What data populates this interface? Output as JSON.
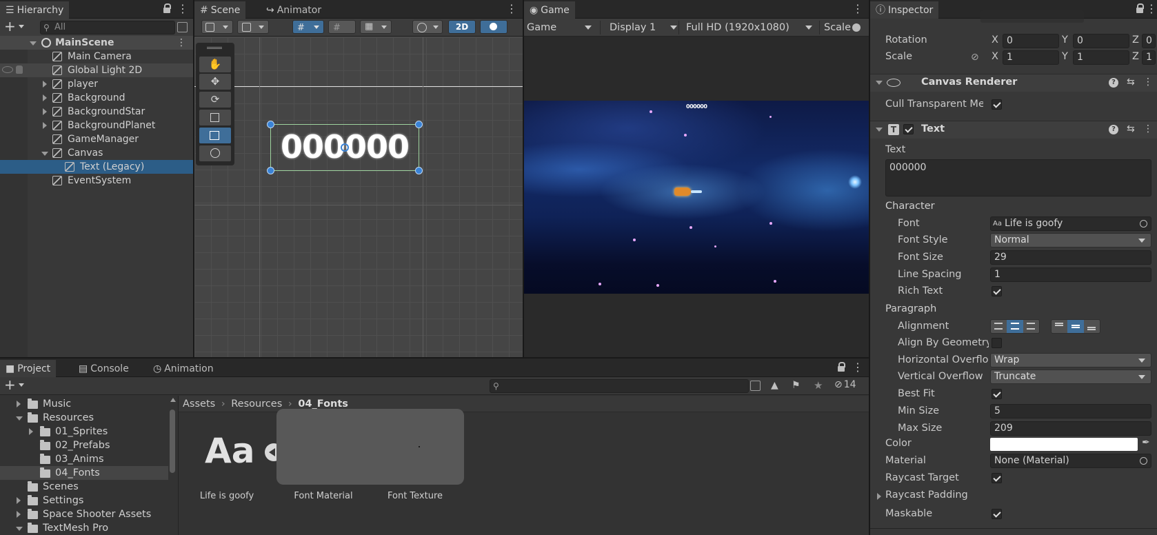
{
  "hierarchy": {
    "tab": "Hierarchy",
    "search_placeholder": "All",
    "scene": "MainScene",
    "items": [
      {
        "label": "Main Camera",
        "depth": 1,
        "expander": "none"
      },
      {
        "label": "Global Light 2D",
        "depth": 1,
        "expander": "none"
      },
      {
        "label": "player",
        "depth": 1,
        "expander": "collapsed"
      },
      {
        "label": "Background",
        "depth": 1,
        "expander": "collapsed"
      },
      {
        "label": "BackgroundStar",
        "depth": 1,
        "expander": "collapsed"
      },
      {
        "label": "BackgroundPlanet",
        "depth": 1,
        "expander": "collapsed"
      },
      {
        "label": "GameManager",
        "depth": 1,
        "expander": "none"
      },
      {
        "label": "Canvas",
        "depth": 1,
        "expander": "expanded"
      },
      {
        "label": "Text (Legacy)",
        "depth": 2,
        "expander": "none"
      },
      {
        "label": "EventSystem",
        "depth": 1,
        "expander": "none"
      }
    ]
  },
  "scene": {
    "tabs": [
      "Scene",
      "Animator"
    ],
    "mode_2d": "2D",
    "text_preview": "000000"
  },
  "game": {
    "tab": "Game",
    "mode": "Game",
    "display": "Display 1",
    "resolution": "Full HD (1920x1080)",
    "scale_label": "Scale",
    "hud_score": "000000"
  },
  "inspector": {
    "tab": "Inspector",
    "rotation_label": "Rotation",
    "scale_label": "Scale",
    "rotation": {
      "x": "0",
      "y": "0",
      "z": "0"
    },
    "scale": {
      "x": "1",
      "y": "1",
      "z": "1"
    },
    "canvas_renderer": {
      "title": "Canvas Renderer",
      "cull_label": "Cull Transparent Mes"
    },
    "text_component": {
      "title": "Text",
      "text_label": "Text",
      "text_value": "000000",
      "character_header": "Character",
      "font_label": "Font",
      "font_value": "Life is goofy",
      "font_style_label": "Font Style",
      "font_style_value": "Normal",
      "font_size_label": "Font Size",
      "font_size_value": "29",
      "line_spacing_label": "Line Spacing",
      "line_spacing_value": "1",
      "rich_text_label": "Rich Text",
      "paragraph_header": "Paragraph",
      "alignment_label": "Alignment",
      "align_geometry_label": "Align By Geometry",
      "h_overflow_label": "Horizontal Overflo",
      "h_overflow_value": "Wrap",
      "v_overflow_label": "Vertical Overflow",
      "v_overflow_value": "Truncate",
      "best_fit_label": "Best Fit",
      "min_size_label": "Min Size",
      "min_size_value": "5",
      "max_size_label": "Max Size",
      "max_size_value": "209",
      "color_label": "Color",
      "color_value": "#ffffff",
      "material_label": "Material",
      "material_value": "None (Material)",
      "raycast_target_label": "Raycast Target",
      "raycast_padding_label": "Raycast Padding",
      "maskable_label": "Maskable"
    }
  },
  "project": {
    "tabs": [
      "Project",
      "Console",
      "Animation"
    ],
    "hidden_count": "14",
    "tree": [
      {
        "label": "Music",
        "depth": 1,
        "expander": "collapsed"
      },
      {
        "label": "Resources",
        "depth": 1,
        "expander": "expanded"
      },
      {
        "label": "01_Sprites",
        "depth": 2,
        "expander": "collapsed"
      },
      {
        "label": "02_Prefabs",
        "depth": 2,
        "expander": "none"
      },
      {
        "label": "03_Anims",
        "depth": 2,
        "expander": "none"
      },
      {
        "label": "04_Fonts",
        "depth": 2,
        "expander": "none"
      },
      {
        "label": "Scenes",
        "depth": 1,
        "expander": "none"
      },
      {
        "label": "Settings",
        "depth": 1,
        "expander": "collapsed"
      },
      {
        "label": "Space Shooter Assets",
        "depth": 1,
        "expander": "collapsed"
      },
      {
        "label": "TextMesh Pro",
        "depth": 1,
        "expander": "expanded"
      }
    ],
    "breadcrumb": [
      "Assets",
      "Resources",
      "04_Fonts"
    ],
    "assets": [
      {
        "label": "Life is goofy",
        "icon": "Aa"
      },
      {
        "label": "Font Material"
      },
      {
        "label": "Font Texture"
      }
    ]
  },
  "colors": {
    "selection": "#2c5d87",
    "accent_blue": "#3d7ec8"
  }
}
